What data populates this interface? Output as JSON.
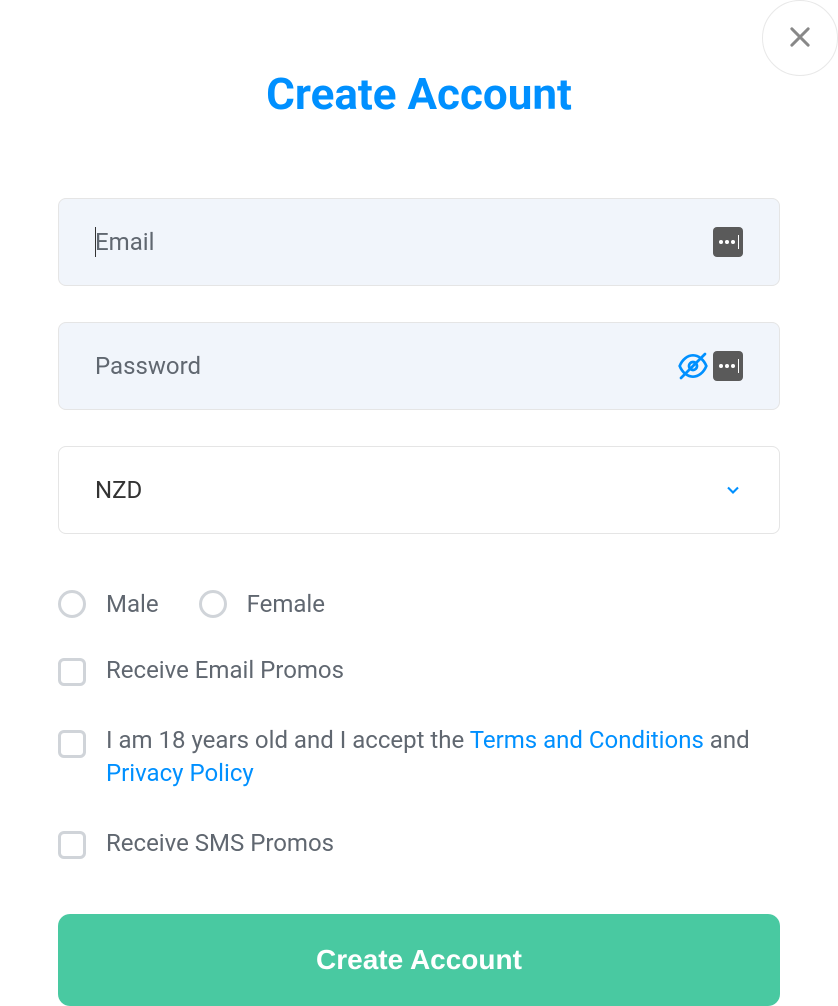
{
  "title": "Create Account",
  "fields": {
    "email": {
      "placeholder": "Email",
      "value": ""
    },
    "password": {
      "placeholder": "Password",
      "value": ""
    },
    "currency": {
      "selected": "NZD"
    }
  },
  "gender": {
    "options": [
      {
        "label": "Male"
      },
      {
        "label": "Female"
      }
    ]
  },
  "checkboxes": {
    "email_promos": "Receive Email Promos",
    "accept": {
      "prefix": "I am 18 years old and I accept the ",
      "terms": "Terms and Conditions",
      "and": " and ",
      "privacy": "Privacy Policy"
    },
    "sms_promos": "Receive SMS Promos"
  },
  "submit_label": "Create Account"
}
